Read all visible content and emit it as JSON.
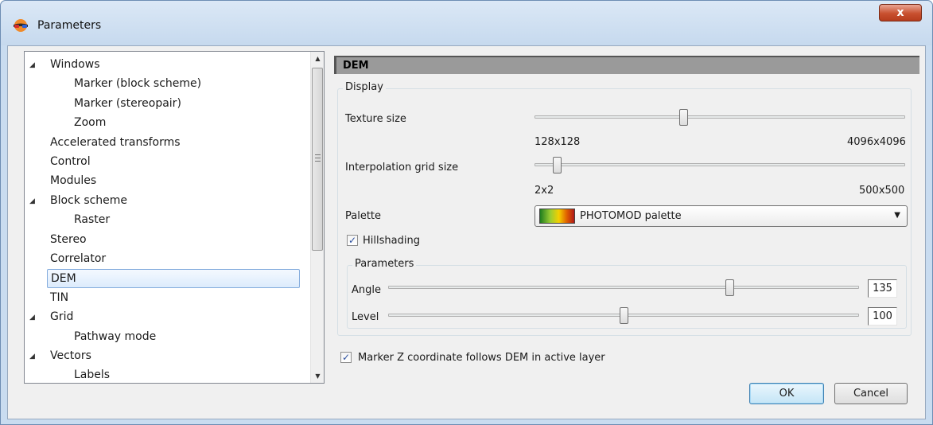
{
  "window": {
    "title": "Parameters",
    "close_label": "x"
  },
  "tree": {
    "items": [
      {
        "label": "Windows",
        "level": 0,
        "expandable": true
      },
      {
        "label": "Marker (block scheme)",
        "level": 1
      },
      {
        "label": "Marker (stereopair)",
        "level": 1
      },
      {
        "label": "Zoom",
        "level": 1
      },
      {
        "label": "Accelerated transforms",
        "level": 0
      },
      {
        "label": "Control",
        "level": 0
      },
      {
        "label": "Modules",
        "level": 0
      },
      {
        "label": "Block scheme",
        "level": 0,
        "expandable": true
      },
      {
        "label": "Raster",
        "level": 1
      },
      {
        "label": "Stereo",
        "level": 0
      },
      {
        "label": "Correlator",
        "level": 0
      },
      {
        "label": "DEM",
        "level": 0,
        "selected": true
      },
      {
        "label": "TIN",
        "level": 0
      },
      {
        "label": "Grid",
        "level": 0,
        "expandable": true
      },
      {
        "label": "Pathway mode",
        "level": 1
      },
      {
        "label": "Vectors",
        "level": 0,
        "expandable": true
      },
      {
        "label": "Labels",
        "level": 1
      }
    ],
    "expander_glyph": "◢",
    "scroll_up_glyph": "▲",
    "scroll_down_glyph": "▼"
  },
  "dem": {
    "header": "DEM",
    "display": {
      "group_title": "Display",
      "texture_size": {
        "label": "Texture size",
        "min_label": "128x128",
        "max_label": "4096x4096",
        "position": 0.4
      },
      "interpolation_grid_size": {
        "label": "Interpolation grid size",
        "min_label": "2x2",
        "max_label": "500x500",
        "position": 0.05
      },
      "palette": {
        "label": "Palette",
        "value": "PHOTOMOD palette",
        "arrow": "▼"
      },
      "hillshading": {
        "label": "Hillshading",
        "checked": true,
        "check_glyph": "✓"
      },
      "parameters": {
        "group_title": "Parameters",
        "angle": {
          "label": "Angle",
          "value": "135",
          "position": 0.73
        },
        "level": {
          "label": "Level",
          "value": "100",
          "position": 0.5
        }
      }
    },
    "marker_z": {
      "label": "Marker Z coordinate follows DEM in active layer",
      "checked": true,
      "check_glyph": "✓"
    }
  },
  "buttons": {
    "ok": "OK",
    "cancel": "Cancel"
  }
}
